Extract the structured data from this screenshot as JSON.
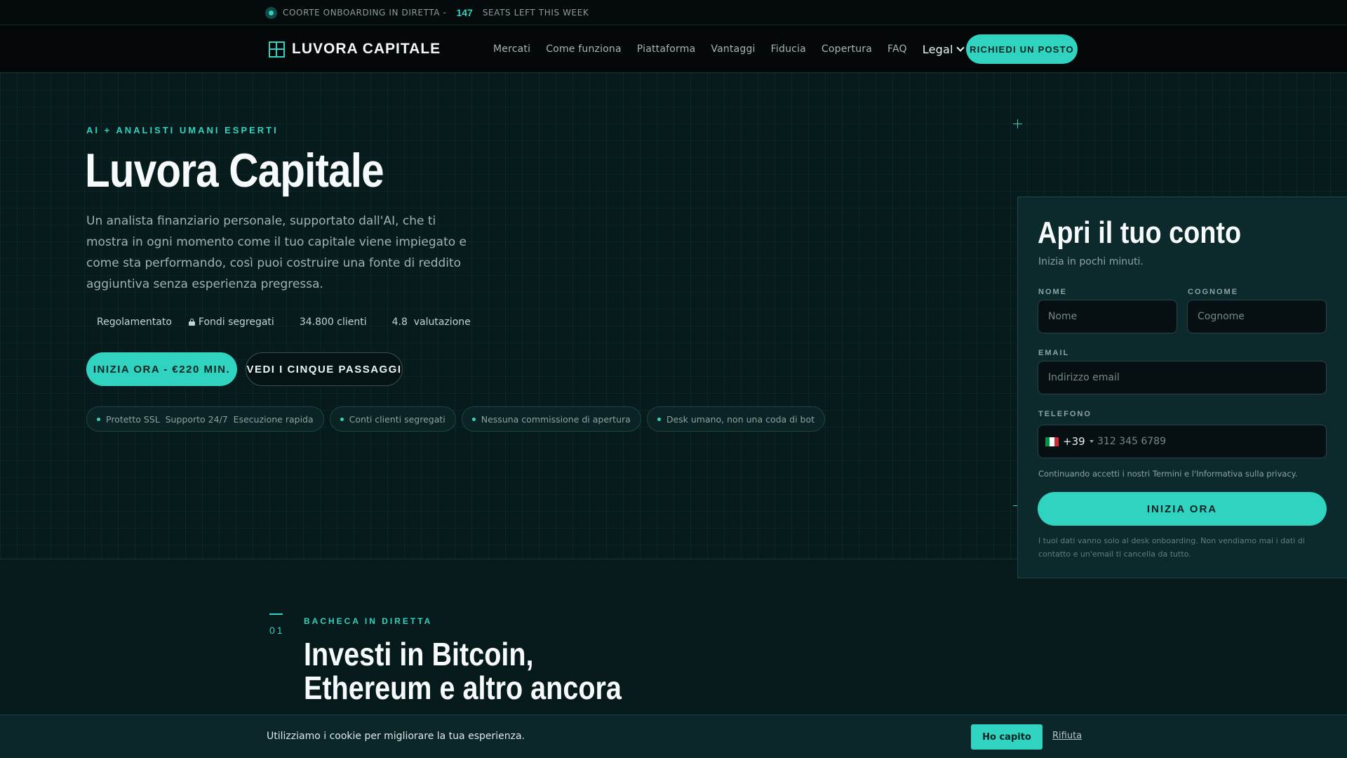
{
  "topbar": {
    "label_left": "COORTE ONBOARDING IN DIRETTA -",
    "seats": "147",
    "label_right": "SEATS LEFT THIS WEEK"
  },
  "nav": {
    "brand": "LUVORA CAPITALE",
    "items": [
      "Mercati",
      "Come funziona",
      "Piattaforma",
      "Vantaggi",
      "Fiducia",
      "Copertura",
      "FAQ"
    ],
    "legal": "Legal",
    "cta": "RICHIEDI UN POSTO"
  },
  "hero": {
    "eyebrow": "AI + ANALISTI UMANI ESPERTI",
    "title": "Luvora Capitale",
    "description": "Un analista finanziario personale, supportato dall'AI, che ti mostra in ogni momento come il tuo capitale viene impiegato e come sta performando, così puoi costruire una fonte di reddito aggiuntiva senza esperienza pregressa.",
    "stats": {
      "regulated": "Regolamentato",
      "segregated": "Fondi segregati",
      "clients": "34.800 clienti",
      "rating": "4.8  valutazione"
    },
    "primary_cta": "INIZIA ORA - €220 MIN.",
    "secondary_cta": "VEDI I CINQUE PASSAGGI",
    "chips": [
      "Protetto SSL  Supporto 24/7  Esecuzione rapida",
      "Conti clienti segregati",
      "Nessuna commissione di apertura",
      "Desk umano, non una coda di bot"
    ]
  },
  "form": {
    "title": "Apri il tuo conto",
    "subtitle": "Inizia in pochi minuti.",
    "first_name_label": "NOME",
    "first_name_placeholder": "Nome",
    "last_name_label": "COGNOME",
    "last_name_placeholder": "Cognome",
    "email_label": "EMAIL",
    "email_placeholder": "Indirizzo email",
    "phone_label": "TELEFONO",
    "country_code": "+39",
    "phone_placeholder": "312 345 6789",
    "terms": "Continuando accetti i nostri Termini e l'Informativa sulla privacy.",
    "submit": "INIZIA ORA",
    "privacy_note": "I tuoi dati vanno solo al desk onboarding. Non vendiamo mai i dati di contatto e un'email ti cancella da tutto."
  },
  "section": {
    "number": "01",
    "eyebrow": "BACHECA IN DIRETTA",
    "title_line1": "Investi in Bitcoin,",
    "title_line2": "Ethereum e altro ancora"
  },
  "cookie": {
    "text": "Utilizziamo i cookie per migliorare la tua esperienza.",
    "accept": "Ho capito",
    "reject": "Rifiuta"
  },
  "colors": {
    "accent": "#2fd3bf",
    "background": "#071b1d",
    "card": "#0c2a2c",
    "flag_green": "#009246",
    "flag_white": "#ffffff",
    "flag_red": "#ce2b37"
  },
  "icons": {
    "live_indicator": "live-dot-icon",
    "logo": "plus-square-icon",
    "legal_dropdown": "chevron-down-icon",
    "lock": "lock-icon",
    "country": "italy-flag-icon",
    "country_dropdown": "caret-down-icon"
  }
}
